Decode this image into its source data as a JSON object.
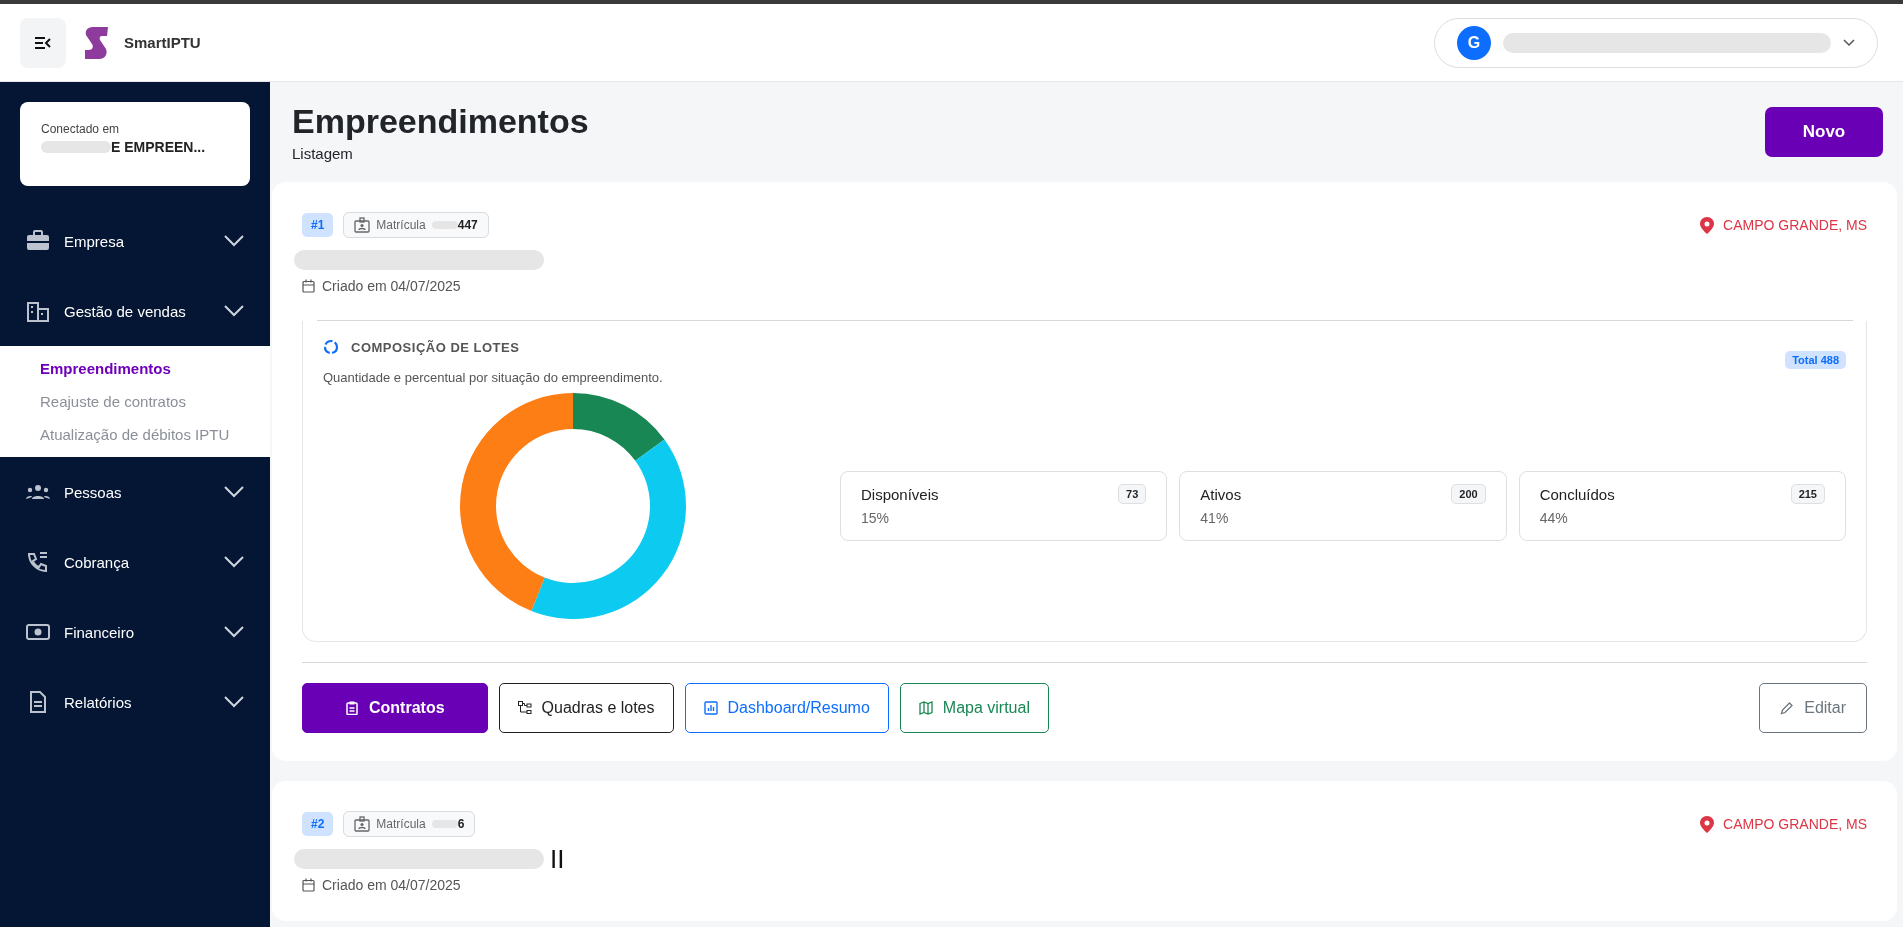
{
  "topbar": {
    "brand": "SmartIPTU",
    "user": {
      "initial": "G"
    }
  },
  "sidebar": {
    "connected": {
      "label": "Conectado em",
      "value": "E EMPREEN..."
    },
    "items": [
      {
        "label": "Empresa"
      },
      {
        "label": "Gestão de vendas",
        "children": [
          {
            "label": "Empreendimentos",
            "selected": true
          },
          {
            "label": "Reajuste de contratos",
            "selected": false
          },
          {
            "label": "Atualização de débitos IPTU",
            "selected": false
          }
        ]
      },
      {
        "label": "Pessoas"
      },
      {
        "label": "Cobrança"
      },
      {
        "label": "Financeiro"
      },
      {
        "label": "Relatórios"
      }
    ]
  },
  "page": {
    "title": "Empreendimentos",
    "subtitle": "Listagem",
    "new_button": "Novo"
  },
  "developments": [
    {
      "index": "#1",
      "matricula_label": "Matrícula",
      "matricula": "447",
      "created": "Criado em 04/07/2025",
      "location": "CAMPO GRANDE, MS",
      "composition": {
        "title": "COMPOSIÇÃO DE LOTES",
        "description": "Quantidade e percentual por situação do empreendimento.",
        "total": "Total 488",
        "chart_data": {
          "type": "donut",
          "categories": [
            "Disponíveis",
            "Ativos",
            "Concluídos"
          ],
          "values": [
            15,
            41,
            44
          ],
          "colors": [
            "#198754",
            "#0dcaf0",
            "#fd7e14"
          ]
        },
        "stats": [
          {
            "count": "73",
            "percent": "15%"
          },
          {
            "count": "200",
            "percent": "41%"
          },
          {
            "count": "215",
            "percent": "44%"
          }
        ]
      },
      "actions": [
        {
          "label": "Contratos",
          "kind": "primary"
        },
        {
          "label": "Quadras e lotes",
          "kind": "dark"
        },
        {
          "label": "Dashboard/Resumo",
          "kind": "info"
        },
        {
          "label": "Mapa virtual",
          "kind": "success"
        },
        {
          "label": "Editar",
          "kind": "edit"
        }
      ]
    },
    {
      "index": "#2",
      "matricula_label": "Matrícula",
      "matricula": "6",
      "title": "II",
      "created": "Criado em 04/07/2025",
      "location": "CAMPO GRANDE, MS"
    }
  ]
}
